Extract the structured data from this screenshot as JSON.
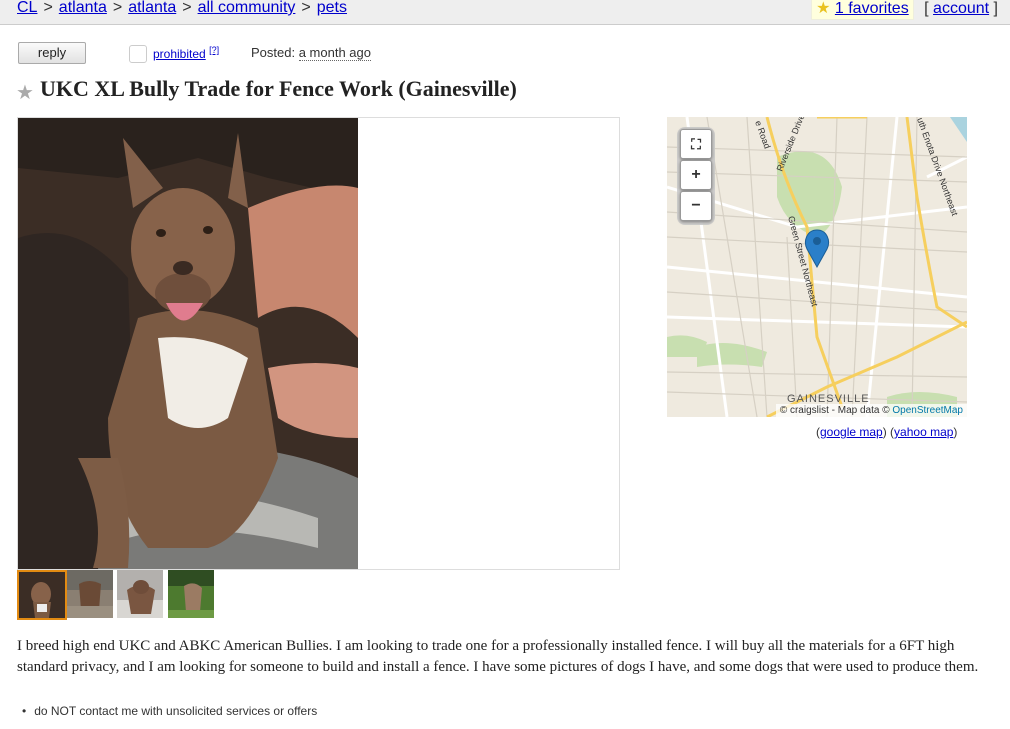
{
  "breadcrumb": {
    "items": [
      "CL",
      "atlanta",
      "atlanta",
      "all community",
      "pets"
    ],
    "separator": ">"
  },
  "userlinks": {
    "favorites_label": "1 favorites",
    "account_label": "account",
    "open_bracket": "[",
    "close_bracket": "]"
  },
  "actions": {
    "reply_label": "reply",
    "prohibited_label": "prohibited",
    "prohibited_note": "[?]"
  },
  "posted": {
    "label": "Posted:",
    "value": "a month ago"
  },
  "posting": {
    "title": "UKC XL Bully Trade for Fence Work (Gainesville)",
    "body": "I breed high end UKC and ABKC American Bullies. I am looking to trade one for a professionally installed fence. I will buy all the materials for a 6FT high standard privacy, and I am looking for someone to build and install a fence. I have some pictures of dogs I have, and some dogs that were used to produce them.",
    "notices": [
      "do NOT contact me with unsolicited services or offers"
    ]
  },
  "map": {
    "attribution_prefix": "© craigslist - Map data ©",
    "attribution_link": "OpenStreetMap",
    "street_labels": [
      "Riverside Drive",
      "Green Street Northeast",
      "e Road",
      "uth Enota Drive Northeast"
    ],
    "city_label": "GAINESVILLE",
    "google_label": "google map",
    "yahoo_label": "yahoo map",
    "controls": [
      "fullscreen-icon",
      "zoom-in-icon",
      "zoom-out-icon"
    ]
  },
  "colors": {
    "link": "#0000cc",
    "topbar": "#eeeeee",
    "thumb_selected": "#e38b12",
    "map_pin": "#2a7fc9"
  }
}
